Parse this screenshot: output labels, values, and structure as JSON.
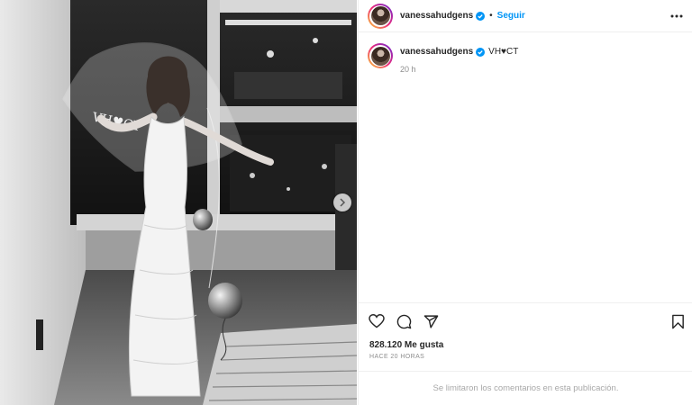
{
  "post": {
    "username": "vanessahudgens",
    "separator": "•",
    "follow_label": "Seguir",
    "caption_username": "vanessahudgens",
    "caption_text": "VH♥CT",
    "caption_time": "20 h",
    "likes": "828.120 Me gusta",
    "posted_ago": "HACE 20 HORAS",
    "comments_disabled_text": "Se limitaron los comentarios en esta publicación.",
    "veil_text": "VH♥CT"
  },
  "icons": {
    "verified": "verified-badge-icon",
    "more": "more-options-icon",
    "like": "heart-icon",
    "comment": "comment-icon",
    "share": "share-icon",
    "save": "bookmark-icon",
    "next": "chevron-right-icon"
  },
  "colors": {
    "follow": "#0095f6",
    "verified": "#0095f6",
    "muted": "#8e8e8e"
  }
}
